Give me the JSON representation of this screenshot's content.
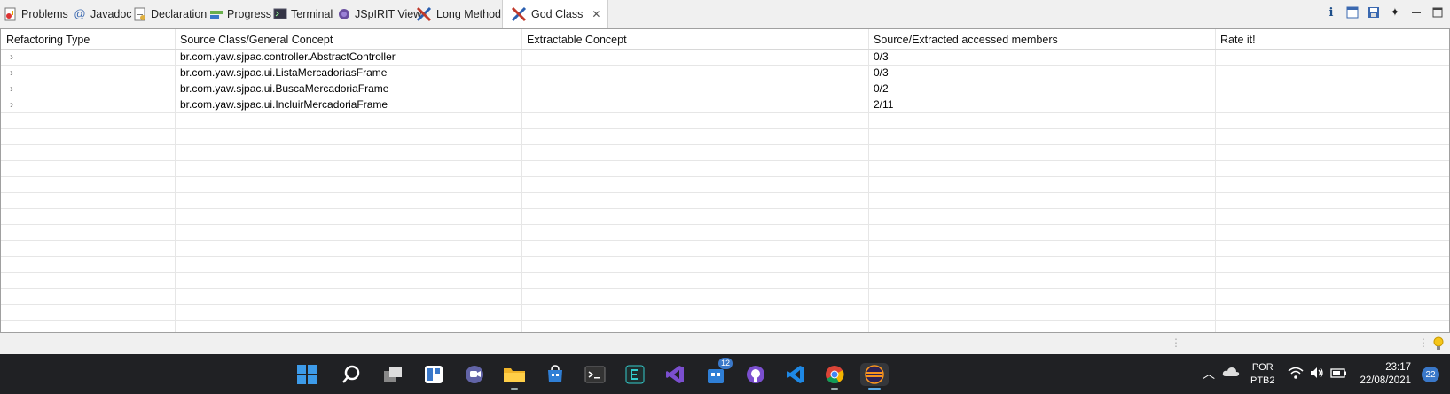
{
  "tabs": [
    {
      "label": "Problems",
      "icon": "problems-icon"
    },
    {
      "label": "Javadoc",
      "icon": "javadoc-icon"
    },
    {
      "label": "Declaration",
      "icon": "declaration-icon"
    },
    {
      "label": "Progress",
      "icon": "progress-icon"
    },
    {
      "label": "Terminal",
      "icon": "terminal-icon"
    },
    {
      "label": "JSpIRIT View",
      "icon": "jspirit-icon"
    },
    {
      "label": "Long Method",
      "icon": "tools-icon"
    },
    {
      "label": "God Class",
      "icon": "tools-icon",
      "active": true
    }
  ],
  "table": {
    "columns": [
      "Refactoring Type",
      "Source Class/General Concept",
      "Extractable Concept",
      "Source/Extracted accessed members",
      "Rate it!"
    ],
    "rows": [
      {
        "type": "",
        "source": "br.com.yaw.sjpac.controller.AbstractController",
        "extractable": "",
        "members": "0/3",
        "rate": ""
      },
      {
        "type": "",
        "source": "br.com.yaw.sjpac.ui.ListaMercadoriasFrame",
        "extractable": "",
        "members": "0/3",
        "rate": ""
      },
      {
        "type": "",
        "source": "br.com.yaw.sjpac.ui.BuscaMercadoriaFrame",
        "extractable": "",
        "members": "0/2",
        "rate": ""
      },
      {
        "type": "",
        "source": "br.com.yaw.sjpac.ui.IncluirMercadoriaFrame",
        "extractable": "",
        "members": "2/11",
        "rate": ""
      }
    ]
  },
  "taskbar": {
    "store_badge": "12",
    "language": "POR",
    "keyboard": "PTB2",
    "time": "23:17",
    "date": "22/08/2021",
    "notifications": "22"
  }
}
